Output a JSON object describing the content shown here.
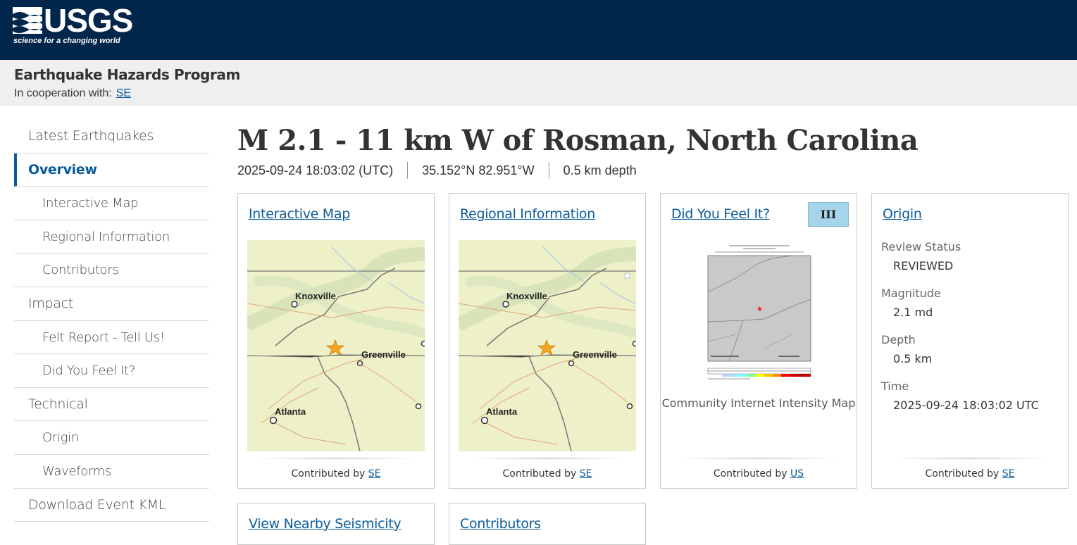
{
  "header": {
    "brand": "USGS",
    "tagline": "science for a changing world",
    "program": "Earthquake Hazards Program",
    "coop_label": "In cooperation with:",
    "coop_link": "SE"
  },
  "sidebar": {
    "items": [
      {
        "label": "Latest Earthquakes"
      },
      {
        "label": "Overview"
      },
      {
        "label": "Interactive Map"
      },
      {
        "label": "Regional Information"
      },
      {
        "label": "Contributors"
      },
      {
        "label": "Impact"
      },
      {
        "label": "Felt Report - Tell Us!"
      },
      {
        "label": "Did You Feel It?"
      },
      {
        "label": "Technical"
      },
      {
        "label": "Origin"
      },
      {
        "label": "Waveforms"
      },
      {
        "label": "Download Event KML"
      }
    ]
  },
  "event": {
    "title": "M 2.1 - 11 km W of Rosman, North Carolina",
    "time": "2025-09-24 18:03:02 (UTC)",
    "location": "35.152°N 82.951°W",
    "depth": "0.5 km depth"
  },
  "cards": {
    "interactive_map": {
      "title": "Interactive Map",
      "contributed_label": "Contributed by",
      "contributor": "SE"
    },
    "regional_info": {
      "title": "Regional Information",
      "contributed_label": "Contributed by",
      "contributor": "SE"
    },
    "dyfi": {
      "title": "Did You Feel It?",
      "badge": "III",
      "caption": "Community Internet Intensity Map",
      "contributed_label": "Contributed by",
      "contributor": "US"
    },
    "origin": {
      "title": "Origin",
      "review_label": "Review Status",
      "review_value": "REVIEWED",
      "magnitude_label": "Magnitude",
      "magnitude_value": "2.1 md",
      "depth_label": "Depth",
      "depth_value": "0.5 km",
      "time_label": "Time",
      "time_value": "2025-09-24 18:03:02 UTC",
      "contributed_label": "Contributed by",
      "contributor": "SE"
    },
    "nearby": {
      "title": "View Nearby Seismicity"
    },
    "contributors": {
      "title": "Contributors"
    }
  },
  "map_labels": {
    "city1": "Knoxville",
    "city2": "Greenville",
    "city3": "Atlanta"
  },
  "colors": {
    "header_bg": "#00264c",
    "link": "#0a5b9c",
    "badge_bg": "#a6d5eb",
    "map_bg": "#eef0c8",
    "star": "#f5a623"
  }
}
